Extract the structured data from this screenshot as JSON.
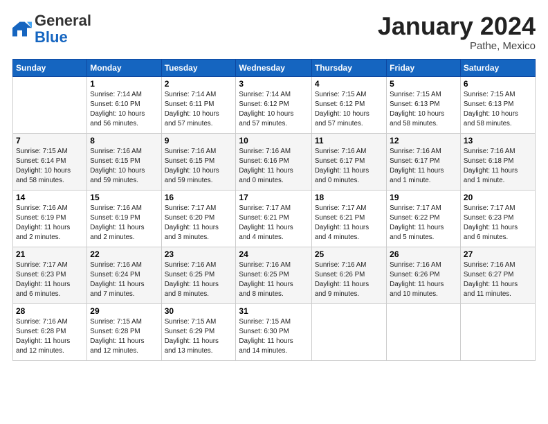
{
  "header": {
    "logo_general": "General",
    "logo_blue": "Blue",
    "month_title": "January 2024",
    "location": "Pathe, Mexico"
  },
  "weekdays": [
    "Sunday",
    "Monday",
    "Tuesday",
    "Wednesday",
    "Thursday",
    "Friday",
    "Saturday"
  ],
  "weeks": [
    [
      {
        "day": "",
        "info": ""
      },
      {
        "day": "1",
        "info": "Sunrise: 7:14 AM\nSunset: 6:10 PM\nDaylight: 10 hours\nand 56 minutes."
      },
      {
        "day": "2",
        "info": "Sunrise: 7:14 AM\nSunset: 6:11 PM\nDaylight: 10 hours\nand 57 minutes."
      },
      {
        "day": "3",
        "info": "Sunrise: 7:14 AM\nSunset: 6:12 PM\nDaylight: 10 hours\nand 57 minutes."
      },
      {
        "day": "4",
        "info": "Sunrise: 7:15 AM\nSunset: 6:12 PM\nDaylight: 10 hours\nand 57 minutes."
      },
      {
        "day": "5",
        "info": "Sunrise: 7:15 AM\nSunset: 6:13 PM\nDaylight: 10 hours\nand 58 minutes."
      },
      {
        "day": "6",
        "info": "Sunrise: 7:15 AM\nSunset: 6:13 PM\nDaylight: 10 hours\nand 58 minutes."
      }
    ],
    [
      {
        "day": "7",
        "info": "Sunrise: 7:15 AM\nSunset: 6:14 PM\nDaylight: 10 hours\nand 58 minutes."
      },
      {
        "day": "8",
        "info": "Sunrise: 7:16 AM\nSunset: 6:15 PM\nDaylight: 10 hours\nand 59 minutes."
      },
      {
        "day": "9",
        "info": "Sunrise: 7:16 AM\nSunset: 6:15 PM\nDaylight: 10 hours\nand 59 minutes."
      },
      {
        "day": "10",
        "info": "Sunrise: 7:16 AM\nSunset: 6:16 PM\nDaylight: 11 hours\nand 0 minutes."
      },
      {
        "day": "11",
        "info": "Sunrise: 7:16 AM\nSunset: 6:17 PM\nDaylight: 11 hours\nand 0 minutes."
      },
      {
        "day": "12",
        "info": "Sunrise: 7:16 AM\nSunset: 6:17 PM\nDaylight: 11 hours\nand 1 minute."
      },
      {
        "day": "13",
        "info": "Sunrise: 7:16 AM\nSunset: 6:18 PM\nDaylight: 11 hours\nand 1 minute."
      }
    ],
    [
      {
        "day": "14",
        "info": "Sunrise: 7:16 AM\nSunset: 6:19 PM\nDaylight: 11 hours\nand 2 minutes."
      },
      {
        "day": "15",
        "info": "Sunrise: 7:16 AM\nSunset: 6:19 PM\nDaylight: 11 hours\nand 2 minutes."
      },
      {
        "day": "16",
        "info": "Sunrise: 7:17 AM\nSunset: 6:20 PM\nDaylight: 11 hours\nand 3 minutes."
      },
      {
        "day": "17",
        "info": "Sunrise: 7:17 AM\nSunset: 6:21 PM\nDaylight: 11 hours\nand 4 minutes."
      },
      {
        "day": "18",
        "info": "Sunrise: 7:17 AM\nSunset: 6:21 PM\nDaylight: 11 hours\nand 4 minutes."
      },
      {
        "day": "19",
        "info": "Sunrise: 7:17 AM\nSunset: 6:22 PM\nDaylight: 11 hours\nand 5 minutes."
      },
      {
        "day": "20",
        "info": "Sunrise: 7:17 AM\nSunset: 6:23 PM\nDaylight: 11 hours\nand 6 minutes."
      }
    ],
    [
      {
        "day": "21",
        "info": "Sunrise: 7:17 AM\nSunset: 6:23 PM\nDaylight: 11 hours\nand 6 minutes."
      },
      {
        "day": "22",
        "info": "Sunrise: 7:16 AM\nSunset: 6:24 PM\nDaylight: 11 hours\nand 7 minutes."
      },
      {
        "day": "23",
        "info": "Sunrise: 7:16 AM\nSunset: 6:25 PM\nDaylight: 11 hours\nand 8 minutes."
      },
      {
        "day": "24",
        "info": "Sunrise: 7:16 AM\nSunset: 6:25 PM\nDaylight: 11 hours\nand 8 minutes."
      },
      {
        "day": "25",
        "info": "Sunrise: 7:16 AM\nSunset: 6:26 PM\nDaylight: 11 hours\nand 9 minutes."
      },
      {
        "day": "26",
        "info": "Sunrise: 7:16 AM\nSunset: 6:26 PM\nDaylight: 11 hours\nand 10 minutes."
      },
      {
        "day": "27",
        "info": "Sunrise: 7:16 AM\nSunset: 6:27 PM\nDaylight: 11 hours\nand 11 minutes."
      }
    ],
    [
      {
        "day": "28",
        "info": "Sunrise: 7:16 AM\nSunset: 6:28 PM\nDaylight: 11 hours\nand 12 minutes."
      },
      {
        "day": "29",
        "info": "Sunrise: 7:15 AM\nSunset: 6:28 PM\nDaylight: 11 hours\nand 12 minutes."
      },
      {
        "day": "30",
        "info": "Sunrise: 7:15 AM\nSunset: 6:29 PM\nDaylight: 11 hours\nand 13 minutes."
      },
      {
        "day": "31",
        "info": "Sunrise: 7:15 AM\nSunset: 6:30 PM\nDaylight: 11 hours\nand 14 minutes."
      },
      {
        "day": "",
        "info": ""
      },
      {
        "day": "",
        "info": ""
      },
      {
        "day": "",
        "info": ""
      }
    ]
  ]
}
